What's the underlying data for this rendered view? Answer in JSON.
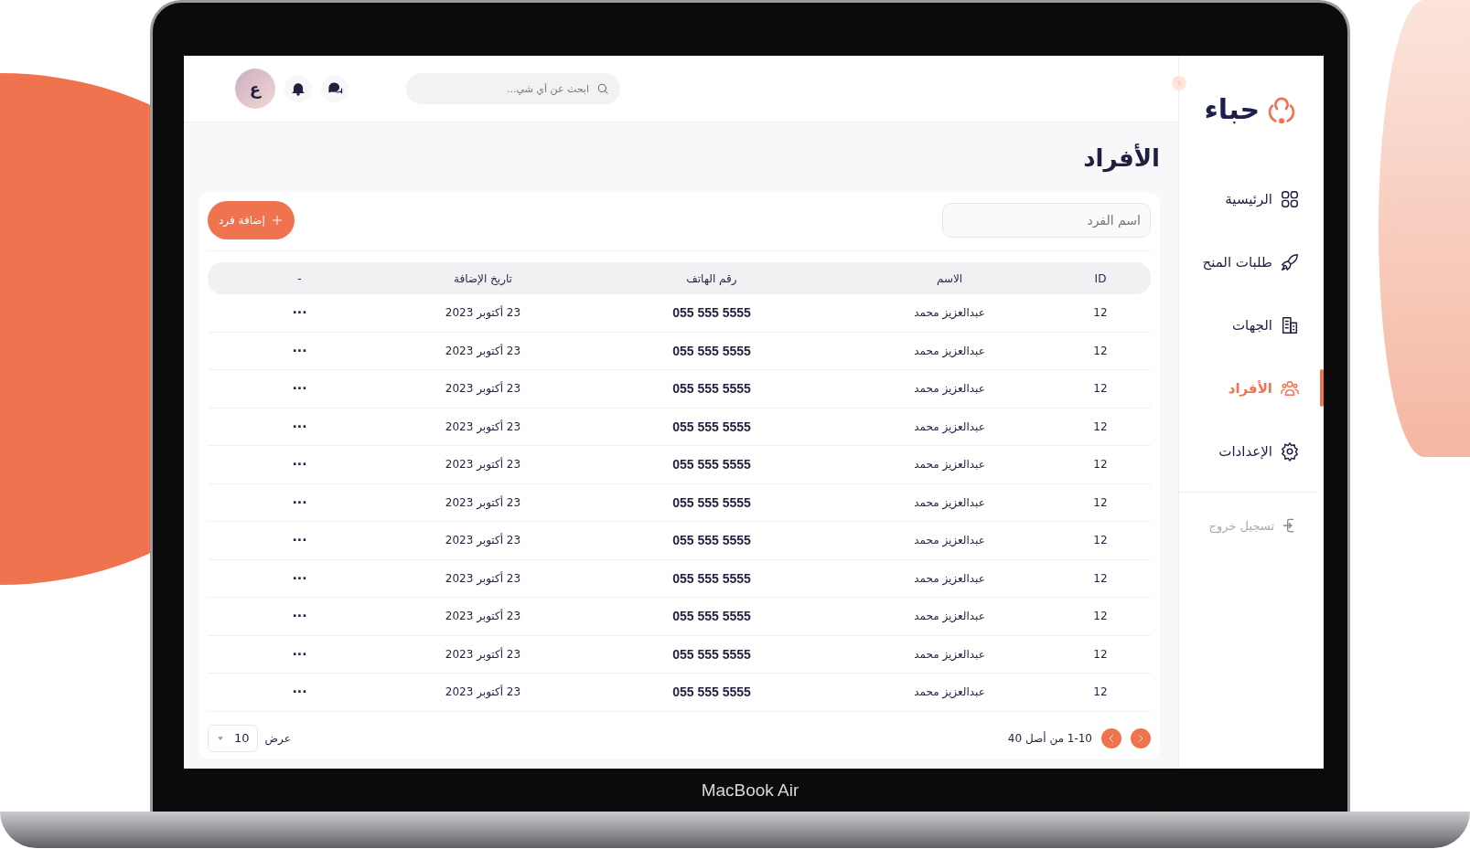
{
  "device": {
    "label": "MacBook Air"
  },
  "sidebar": {
    "logo": "حباء",
    "items": [
      {
        "label": "الرئيسية",
        "kind": "home",
        "selected": false
      },
      {
        "label": "طلبات المنح",
        "kind": "grants",
        "selected": false
      },
      {
        "label": "الجهات",
        "kind": "entities",
        "selected": false
      },
      {
        "label": "الأفراد",
        "kind": "individuals",
        "selected": true
      },
      {
        "label": "الإعدادات",
        "kind": "settings",
        "selected": false
      }
    ],
    "logout": "تسجيل خروج"
  },
  "topbar": {
    "search": {
      "placeholder": "ابحث عن أي شي..."
    },
    "avatar": "ع"
  },
  "page": {
    "title": "الأفراد",
    "filter": {
      "placeholder": "اسم الفرد"
    },
    "add_button": "إضافة فرد"
  },
  "table": {
    "columns": [
      "ID",
      "الاسم",
      "رقم الهاتف",
      "تاريخ الإضافة",
      "-"
    ],
    "rows": [
      {
        "id": "12",
        "name": "عبدالعزيز محمد",
        "phone": "055 555 5555",
        "date": "23 أكتوبر 2023",
        "actions": "···"
      },
      {
        "id": "12",
        "name": "عبدالعزيز محمد",
        "phone": "055 555 5555",
        "date": "23 أكتوبر 2023",
        "actions": "···"
      },
      {
        "id": "12",
        "name": "عبدالعزيز محمد",
        "phone": "055 555 5555",
        "date": "23 أكتوبر 2023",
        "actions": "···"
      },
      {
        "id": "12",
        "name": "عبدالعزيز محمد",
        "phone": "055 555 5555",
        "date": "23 أكتوبر 2023",
        "actions": "···"
      },
      {
        "id": "12",
        "name": "عبدالعزيز محمد",
        "phone": "055 555 5555",
        "date": "23 أكتوبر 2023",
        "actions": "···"
      },
      {
        "id": "12",
        "name": "عبدالعزيز محمد",
        "phone": "055 555 5555",
        "date": "23 أكتوبر 2023",
        "actions": "···"
      },
      {
        "id": "12",
        "name": "عبدالعزيز محمد",
        "phone": "055 555 5555",
        "date": "23 أكتوبر 2023",
        "actions": "···"
      },
      {
        "id": "12",
        "name": "عبدالعزيز محمد",
        "phone": "055 555 5555",
        "date": "23 أكتوبر 2023",
        "actions": "···"
      },
      {
        "id": "12",
        "name": "عبدالعزيز محمد",
        "phone": "055 555 5555",
        "date": "23 أكتوبر 2023",
        "actions": "···"
      },
      {
        "id": "12",
        "name": "عبدالعزيز محمد",
        "phone": "055 555 5555",
        "date": "23 أكتوبر 2023",
        "actions": "···"
      },
      {
        "id": "12",
        "name": "عبدالعزيز محمد",
        "phone": "055 555 5555",
        "date": "23 أكتوبر 2023",
        "actions": "···"
      }
    ]
  },
  "pagination": {
    "range": "1-10 من أصل 40",
    "per_page_label": "عرض",
    "per_page": "10"
  }
}
